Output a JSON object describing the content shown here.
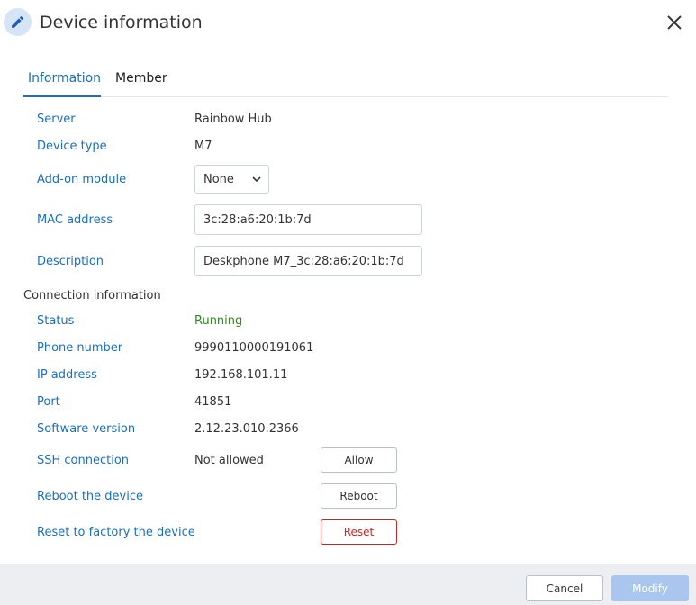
{
  "dialog": {
    "title": "Device information",
    "header_icon": "pencil-icon",
    "close_icon": "close-icon"
  },
  "tabs": [
    {
      "label": "Information",
      "active": true
    },
    {
      "label": "Member",
      "active": false
    }
  ],
  "info": {
    "server": {
      "label": "Server",
      "value": "Rainbow Hub"
    },
    "device_type": {
      "label": "Device type",
      "value": "M7"
    },
    "addon_module": {
      "label": "Add-on module",
      "selected": "None"
    },
    "mac_address": {
      "label": "MAC address",
      "value": "3c:28:a6:20:1b:7d"
    },
    "description": {
      "label": "Description",
      "value": "Deskphone M7_3c:28:a6:20:1b:7d"
    }
  },
  "connection": {
    "section_title": "Connection information",
    "status": {
      "label": "Status",
      "value": "Running",
      "color": "#2e8a1e"
    },
    "phone_number": {
      "label": "Phone number",
      "value": "9990110000191061"
    },
    "ip_address": {
      "label": "IP address",
      "value": "192.168.101.11"
    },
    "port": {
      "label": "Port",
      "value": "41851"
    },
    "software_version": {
      "label": "Software version",
      "value": "2.12.23.010.2366"
    },
    "ssh": {
      "label": "SSH connection",
      "value": "Not allowed",
      "button": "Allow"
    },
    "reboot": {
      "label": "Reboot the device",
      "button": "Reboot"
    },
    "reset": {
      "label": "Reset to factory the device",
      "button": "Reset",
      "color": "#c62828"
    }
  },
  "footer": {
    "cancel": "Cancel",
    "modify": "Modify"
  },
  "colors": {
    "accent": "#1a6fc0",
    "modify_disabled": "#a9c7ee"
  }
}
